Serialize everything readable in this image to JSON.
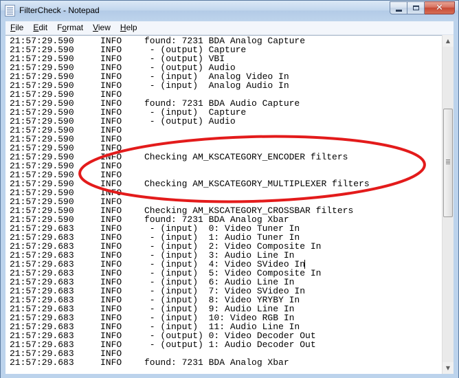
{
  "window": {
    "title": "FilterCheck - Notepad",
    "close_glyph": "✕"
  },
  "menu": [
    {
      "pre": "",
      "acc": "F",
      "post": "ile"
    },
    {
      "pre": "",
      "acc": "E",
      "post": "dit"
    },
    {
      "pre": "F",
      "acc": "o",
      "post": "rmat"
    },
    {
      "pre": "",
      "acc": "V",
      "post": "iew"
    },
    {
      "pre": "",
      "acc": "H",
      "post": "elp"
    }
  ],
  "scrollbar": {
    "up_arrow": "▲",
    "down_arrow": "▼"
  },
  "log_lines": [
    {
      "ts": "21:57:29.590",
      "lvl": "INFO",
      "msg": "found: 7231 BDA Analog Capture"
    },
    {
      "ts": "21:57:29.590",
      "lvl": "INFO",
      "msg": " - (output) Capture"
    },
    {
      "ts": "21:57:29.590",
      "lvl": "INFO",
      "msg": " - (output) VBI"
    },
    {
      "ts": "21:57:29.590",
      "lvl": "INFO",
      "msg": " - (output) Audio"
    },
    {
      "ts": "21:57:29.590",
      "lvl": "INFO",
      "msg": " - (input)  Analog Video In"
    },
    {
      "ts": "21:57:29.590",
      "lvl": "INFO",
      "msg": " - (input)  Analog Audio In"
    },
    {
      "ts": "21:57:29.590",
      "lvl": "INFO",
      "msg": ""
    },
    {
      "ts": "21:57:29.590",
      "lvl": "INFO",
      "msg": "found: 7231 BDA Audio Capture"
    },
    {
      "ts": "21:57:29.590",
      "lvl": "INFO",
      "msg": " - (input)  Capture"
    },
    {
      "ts": "21:57:29.590",
      "lvl": "INFO",
      "msg": " - (output) Audio"
    },
    {
      "ts": "21:57:29.590",
      "lvl": "INFO",
      "msg": ""
    },
    {
      "ts": "21:57:29.590",
      "lvl": "INFO",
      "msg": ""
    },
    {
      "ts": "21:57:29.590",
      "lvl": "INFO",
      "msg": ""
    },
    {
      "ts": "21:57:29.590",
      "lvl": "INFO",
      "msg": "Checking AM_KSCATEGORY_ENCODER filters"
    },
    {
      "ts": "21:57:29.590",
      "lvl": "INFO",
      "msg": ""
    },
    {
      "ts": "21:57:29.590",
      "lvl": "INFO",
      "msg": ""
    },
    {
      "ts": "21:57:29.590",
      "lvl": "INFO",
      "msg": "Checking AM_KSCATEGORY_MULTIPLEXER filters"
    },
    {
      "ts": "21:57:29.590",
      "lvl": "INFO",
      "msg": ""
    },
    {
      "ts": "21:57:29.590",
      "lvl": "INFO",
      "msg": ""
    },
    {
      "ts": "21:57:29.590",
      "lvl": "INFO",
      "msg": "Checking AM_KSCATEGORY_CROSSBAR filters"
    },
    {
      "ts": "21:57:29.590",
      "lvl": "INFO",
      "msg": "found: 7231 BDA Analog Xbar"
    },
    {
      "ts": "21:57:29.683",
      "lvl": "INFO",
      "msg": " - (input)  0: Video Tuner In"
    },
    {
      "ts": "21:57:29.683",
      "lvl": "INFO",
      "msg": " - (input)  1: Audio Tuner In"
    },
    {
      "ts": "21:57:29.683",
      "lvl": "INFO",
      "msg": " - (input)  2: Video Composite In"
    },
    {
      "ts": "21:57:29.683",
      "lvl": "INFO",
      "msg": " - (input)  3: Audio Line In"
    },
    {
      "ts": "21:57:29.683",
      "lvl": "INFO",
      "msg": " - (input)  4: Video SVideo In"
    },
    {
      "ts": "21:57:29.683",
      "lvl": "INFO",
      "msg": " - (input)  5: Video Composite In"
    },
    {
      "ts": "21:57:29.683",
      "lvl": "INFO",
      "msg": " - (input)  6: Audio Line In"
    },
    {
      "ts": "21:57:29.683",
      "lvl": "INFO",
      "msg": " - (input)  7: Video SVideo In"
    },
    {
      "ts": "21:57:29.683",
      "lvl": "INFO",
      "msg": " - (input)  8: Video YRYBY In"
    },
    {
      "ts": "21:57:29.683",
      "lvl": "INFO",
      "msg": " - (input)  9: Audio Line In"
    },
    {
      "ts": "21:57:29.683",
      "lvl": "INFO",
      "msg": " - (input)  10: Video RGB In"
    },
    {
      "ts": "21:57:29.683",
      "lvl": "INFO",
      "msg": " - (input)  11: Audio Line In"
    },
    {
      "ts": "21:57:29.683",
      "lvl": "INFO",
      "msg": " - (output) 0: Video Decoder Out"
    },
    {
      "ts": "21:57:29.683",
      "lvl": "INFO",
      "msg": " - (output) 1: Audio Decoder Out"
    },
    {
      "ts": "21:57:29.683",
      "lvl": "INFO",
      "msg": ""
    },
    {
      "ts": "21:57:29.683",
      "lvl": "INFO",
      "msg": "found: 7231 BDA Analog Xbar"
    }
  ],
  "annotation": {
    "color": "#e31b1b"
  }
}
